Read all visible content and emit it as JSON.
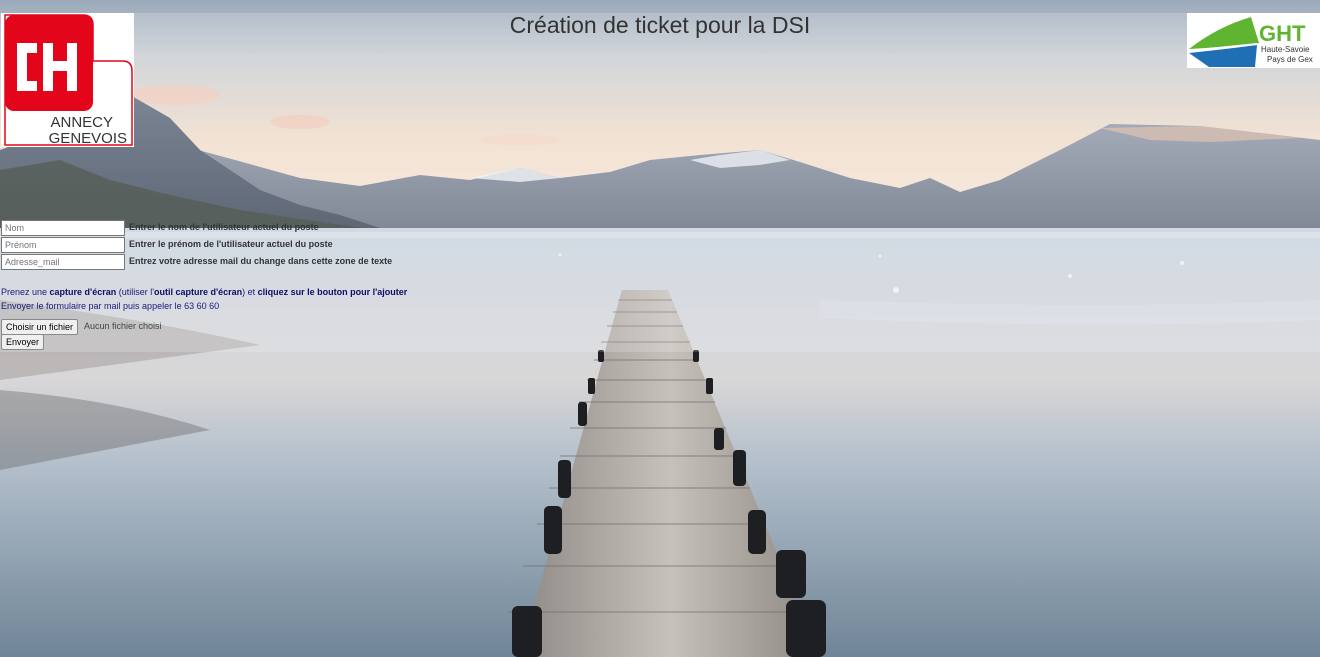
{
  "page": {
    "title": "Création de ticket pour la DSI"
  },
  "logos": {
    "left": {
      "letters": "CH",
      "line1": "ANNECY",
      "line2": "GENEVOIS",
      "color": "#e3061a"
    },
    "right": {
      "letters": "GHT",
      "line1": "Haute-Savoie",
      "line2": "Pays de Gex",
      "green": "#5fb532",
      "blue": "#1f6fb5"
    }
  },
  "form": {
    "nom": {
      "placeholder": "Nom",
      "hint": "Entrer le nom de l'utilisateur actuel du poste"
    },
    "prenom": {
      "placeholder": "Prénom",
      "hint": "Entrer le prénom de l'utilisateur actuel du poste"
    },
    "mail": {
      "placeholder": "Adresse_mail",
      "hint": "Entrez votre adresse mail du change dans cette zone de texte"
    },
    "instruction1": {
      "p1": "Prenez une ",
      "p2": "capture d'écran",
      "p3": " (utiliser l'",
      "p4": "outil capture d'écran",
      "p5": ") et ",
      "p6": "cliquez sur le bouton pour l'ajouter"
    },
    "instruction2": "Envoyer le formulaire par mail puis appeler le 63 60 60",
    "file_button": "Choisir un fichier",
    "file_status": "Aucun fichier choisi",
    "submit": "Envoyer"
  },
  "colors": {
    "link_text": "#1a1a7a",
    "sky_top": "#9fb3c8",
    "water": "#b7c7d6"
  }
}
